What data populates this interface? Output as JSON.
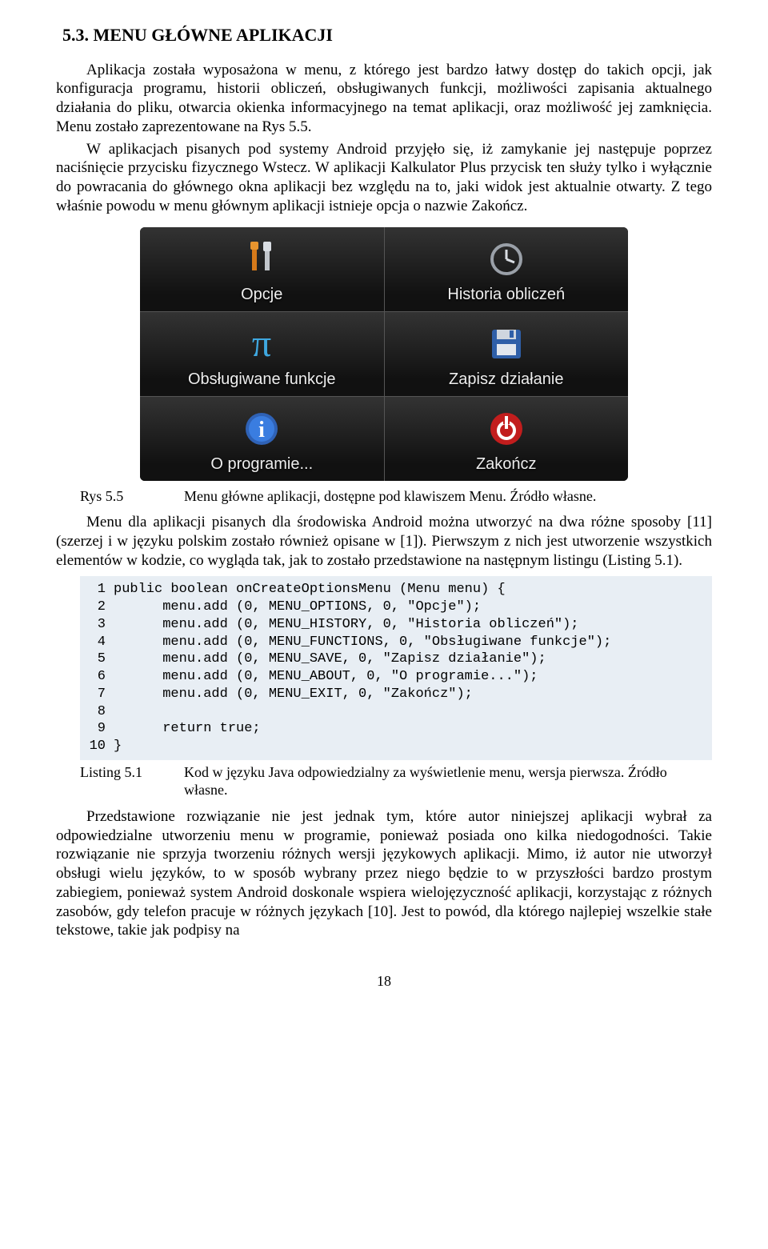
{
  "section_heading": "5.3. MENU GŁÓWNE APLIKACJI",
  "para1": "Aplikacja została wyposażona w menu, z którego jest bardzo łatwy dostęp do takich opcji, jak konfiguracja programu, historii obliczeń, obsługiwanych funkcji, możliwości zapisania aktualnego działania do pliku, otwarcia okienka informacyjnego na temat aplikacji, oraz możliwość jej zamknięcia. Menu zostało zaprezentowane na Rys 5.5.",
  "para2": "W aplikacjach pisanych pod systemy Android przyjęło się, iż zamykanie jej następuje poprzez naciśnięcie przycisku fizycznego Wstecz. W aplikacji Kalkulator Plus przycisk ten służy tylko i wyłącznie do powracania do głównego okna aplikacji bez względu na to, jaki widok jest aktualnie otwarty. Z tego właśnie powodu w menu głównym aplikacji istnieje opcja o nazwie Zakończ.",
  "menu": {
    "opcje": "Opcje",
    "historia": "Historia obliczeń",
    "funkcje": "Obsługiwane funkcje",
    "zapisz": "Zapisz działanie",
    "oprogramie": "O programie...",
    "zakoncz": "Zakończ"
  },
  "fig_caption_label": "Rys 5.5",
  "fig_caption_text": "Menu główne aplikacji, dostępne pod klawiszem Menu. Źródło własne.",
  "para3": "Menu dla aplikacji pisanych dla środowiska Android można utworzyć na dwa różne sposoby [11] (szerzej i w języku polskim zostało również opisane w [1]). Pierwszym z nich jest utworzenie wszystkich elementów w kodzie, co wygląda tak, jak to zostało przedstawione na następnym listingu (Listing 5.1).",
  "listing": {
    "lines": [
      "public boolean onCreateOptionsMenu (Menu menu) {",
      "      menu.add (0, MENU_OPTIONS, 0, \"Opcje\");",
      "      menu.add (0, MENU_HISTORY, 0, \"Historia obliczeń\");",
      "      menu.add (0, MENU_FUNCTIONS, 0, \"Obsługiwane funkcje\");",
      "      menu.add (0, MENU_SAVE, 0, \"Zapisz działanie\");",
      "      menu.add (0, MENU_ABOUT, 0, \"O programie...\");",
      "      menu.add (0, MENU_EXIT, 0, \"Zakończ\");",
      "",
      "      return true;",
      "}"
    ]
  },
  "listing_caption_label": "Listing 5.1",
  "listing_caption_text": "Kod w języku Java odpowiedzialny za wyświetlenie menu, wersja pierwsza. Źródło własne.",
  "para4": "Przedstawione rozwiązanie nie jest jednak tym, które autor niniejszej aplikacji wybrał za odpowiedzialne utworzeniu menu w programie, ponieważ posiada ono kilka niedogodności. Takie rozwiązanie nie sprzyja tworzeniu różnych wersji językowych aplikacji. Mimo, iż autor nie utworzył obsługi wielu języków, to w sposób wybrany przez niego będzie to w przyszłości bardzo prostym zabiegiem, ponieważ system Android doskonale wspiera wielojęzyczność aplikacji, korzystając z różnych zasobów, gdy telefon pracuje w różnych językach [10]. Jest to powód, dla którego najlepiej wszelkie stałe tekstowe, takie jak podpisy na",
  "page_number": "18"
}
